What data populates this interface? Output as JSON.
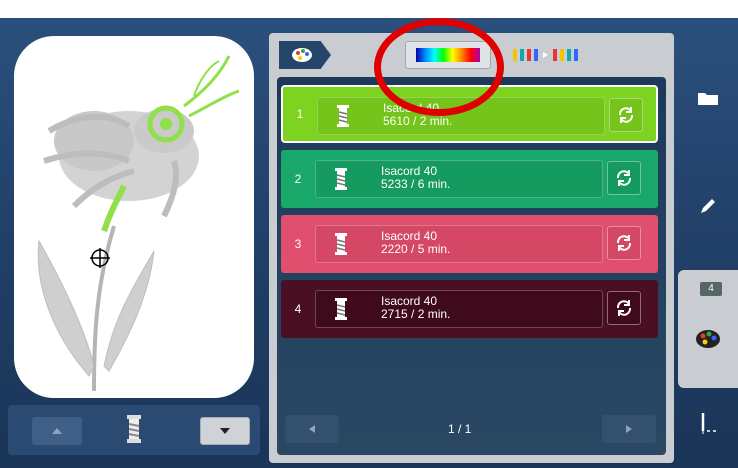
{
  "colors": {
    "background": "#1f3d64",
    "panel": "#c9cdd2",
    "highlight": "#e00000"
  },
  "thread_list": [
    {
      "number": "1",
      "brand": "Isacord 40",
      "info": "5610 / 2 min.",
      "color": "#7ed321",
      "selected": true
    },
    {
      "number": "2",
      "brand": "Isacord 40",
      "info": "5233 / 6 min.",
      "color": "#1aa86a",
      "selected": false
    },
    {
      "number": "3",
      "brand": "Isacord 40",
      "info": "2220 / 5 min.",
      "color": "#e0506e",
      "selected": false
    },
    {
      "number": "4",
      "brand": "Isacord 40",
      "info": "2715 / 2 min.",
      "color": "#4a0f22",
      "selected": false
    }
  ],
  "pagination": {
    "label": "1 / 1"
  },
  "sidebar": {
    "badge": "4"
  },
  "icons": {
    "palette": "palette-icon",
    "color_wheel": "rainbow-color-icon",
    "sort": "thread-sort-icon",
    "folder": "folder-icon",
    "edit": "pencil-icon",
    "colors": "palette-icon",
    "stitch": "needle-icon",
    "spool": "spool-icon",
    "sync": "sync-icon"
  }
}
